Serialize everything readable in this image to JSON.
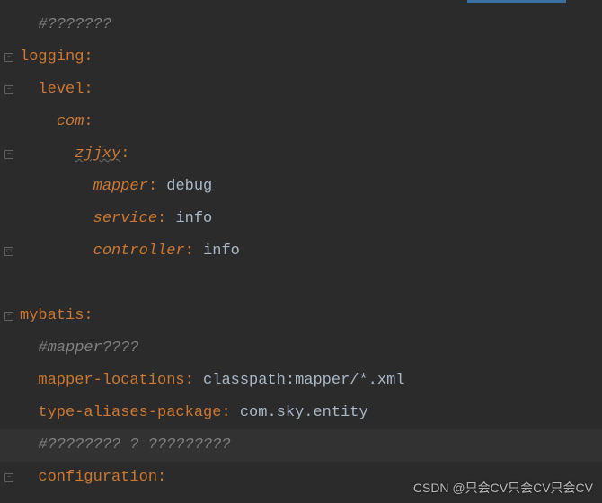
{
  "lines": [
    {
      "type": "comment",
      "indent": 1,
      "text": "#???????"
    },
    {
      "type": "key",
      "indent": 0,
      "key": "logging",
      "fold": "minus"
    },
    {
      "type": "key",
      "indent": 1,
      "key": "level",
      "fold": "minus"
    },
    {
      "type": "key-italic",
      "indent": 2,
      "key": "com",
      "fold": "none"
    },
    {
      "type": "key-underline",
      "indent": 3,
      "key": "zjjxy",
      "fold": "minus"
    },
    {
      "type": "kv-italic",
      "indent": 4,
      "key": "mapper",
      "value": "debug"
    },
    {
      "type": "kv-italic",
      "indent": 4,
      "key": "service",
      "value": "info"
    },
    {
      "type": "kv-italic",
      "indent": 4,
      "key": "controller",
      "value": "info",
      "fold": "close"
    },
    {
      "type": "blank"
    },
    {
      "type": "key",
      "indent": 0,
      "key": "mybatis",
      "fold": "minus"
    },
    {
      "type": "comment-italic",
      "indent": 1,
      "text": "#mapper????"
    },
    {
      "type": "kv",
      "indent": 1,
      "key": "mapper-locations",
      "value": "classpath:mapper/*.xml"
    },
    {
      "type": "kv",
      "indent": 1,
      "key": "type-aliases-package",
      "value": "com.sky.entity"
    },
    {
      "type": "comment-hl",
      "indent": 1,
      "text": "#???????? ? ?????????"
    },
    {
      "type": "key",
      "indent": 1,
      "key": "configuration",
      "fold": "minus"
    }
  ],
  "watermark": "CSDN @只会CV只会CV只会CV"
}
